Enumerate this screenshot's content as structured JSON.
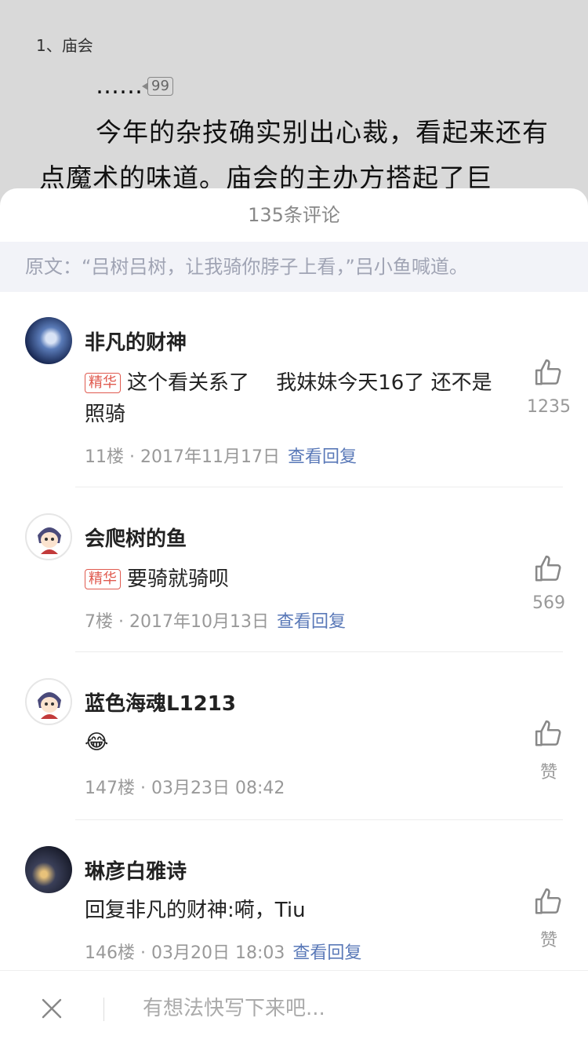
{
  "reader": {
    "chapter": "1、庙会",
    "ellipsis": "……",
    "comment_count_badge": "99",
    "paragraph": "今年的杂技确实别出心裁，看起来还有点魔术的味道。庙会的主办方搭起了巨"
  },
  "sheet": {
    "title": "135条评论",
    "origin": "原文：“吕树吕树，让我骑你脖子上看，”吕小鱼喊道。"
  },
  "comments": [
    {
      "name": "非凡的财神",
      "tag": "精华",
      "text": "这个看关系了　 我妹妹今天16了 还不是照骑",
      "meta": "11楼 · 2017年11月17日",
      "reply": "查看回复",
      "likes": "1235"
    },
    {
      "name": "会爬树的鱼",
      "tag": "精华",
      "text": "要骑就骑呗",
      "meta": "7楼 · 2017年10月13日",
      "reply": "查看回复",
      "likes": "569"
    },
    {
      "name": "蓝色海魂L1213",
      "tag": "",
      "text": "😂",
      "meta": "147楼 · 03月23日 08:42",
      "reply": "",
      "likes": "赞"
    },
    {
      "name": "琳彦白雅诗",
      "tag": "",
      "text": "回复非凡的财神:嗬，Tiu",
      "meta": "146楼 · 03月20日 18:03",
      "reply": "查看回复",
      "likes": "赞"
    }
  ],
  "bottom_bar": {
    "placeholder": "有想法快写下来吧..."
  },
  "icons": {
    "like": "thumbs-up-icon",
    "close": "close-icon"
  },
  "colors": {
    "tag_red": "#e05a4f",
    "link_blue": "#5a79b8",
    "origin_bg": "#f2f3f8"
  }
}
